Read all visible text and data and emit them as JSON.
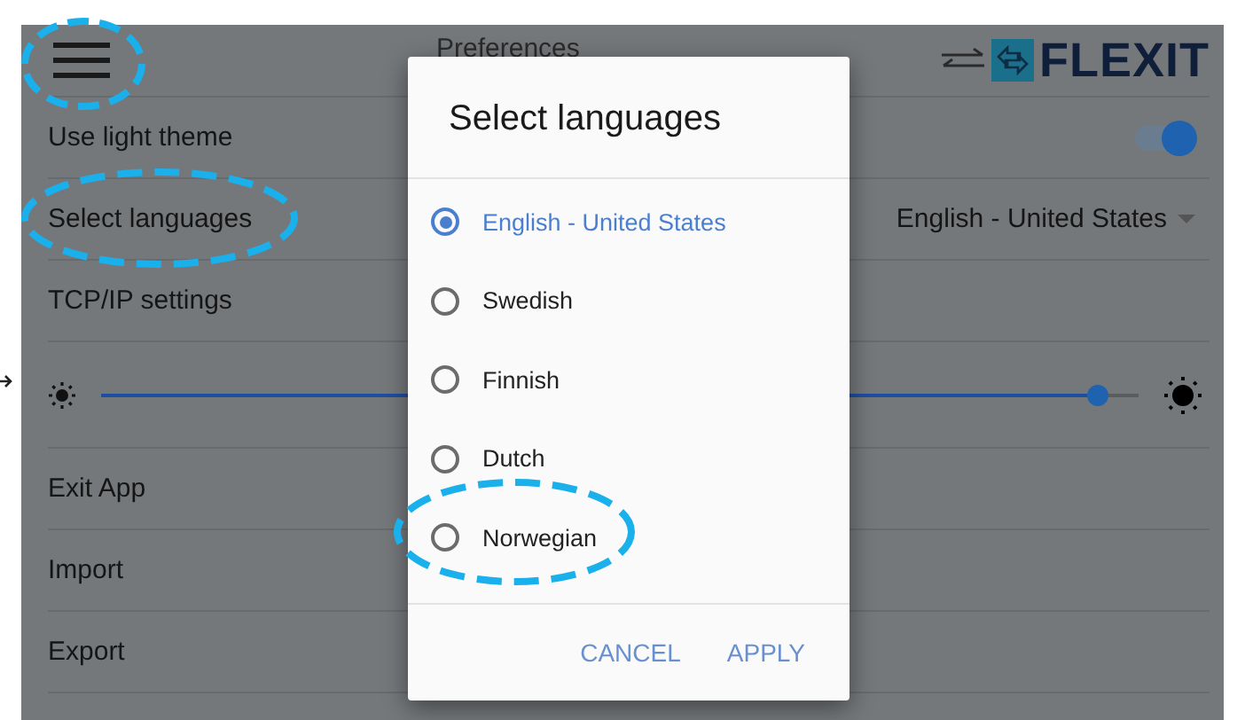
{
  "header": {
    "title": "Preferences",
    "logo_text": "FLEXIT"
  },
  "settings": [
    {
      "kind": "toggle",
      "label": "Use light theme",
      "on": true
    },
    {
      "kind": "dropdown",
      "label": "Select languages",
      "value": "English - United States"
    },
    {
      "kind": "link",
      "label": "TCP/IP settings"
    },
    {
      "kind": "slider",
      "level": 0.96
    },
    {
      "kind": "link",
      "label": "Exit App"
    },
    {
      "kind": "link",
      "label": "Import"
    },
    {
      "kind": "link",
      "label": "Export"
    }
  ],
  "dialog": {
    "title": "Select languages",
    "options": [
      {
        "label": "English - United States",
        "selected": true
      },
      {
        "label": "Swedish",
        "selected": false
      },
      {
        "label": "Finnish",
        "selected": false
      },
      {
        "label": "Dutch",
        "selected": false
      },
      {
        "label": "Norwegian",
        "selected": false
      }
    ],
    "buttons": [
      "CANCEL",
      "APPLY"
    ]
  }
}
